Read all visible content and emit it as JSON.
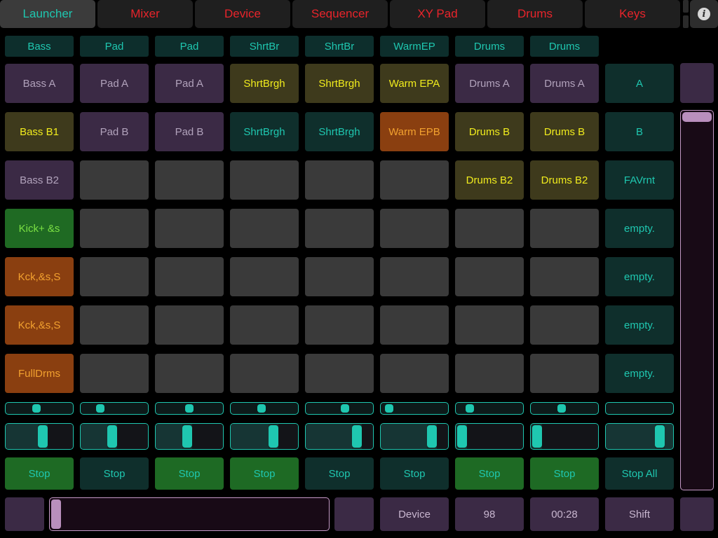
{
  "tabs": [
    {
      "label": "Launcher",
      "active": true
    },
    {
      "label": "Mixer",
      "active": false
    },
    {
      "label": "Device",
      "active": false
    },
    {
      "label": "Sequencer",
      "active": false
    },
    {
      "label": "XY Pad",
      "active": false
    },
    {
      "label": "Drums",
      "active": false
    },
    {
      "label": "Keys",
      "active": false
    }
  ],
  "info_icon": {
    "glyph": "i",
    "icon": "info-icon"
  },
  "tracks": [
    {
      "name": "Bass",
      "clips": [
        {
          "label": "Bass A",
          "style": "purple"
        },
        {
          "label": "Bass B1",
          "style": "olive"
        },
        {
          "label": "Bass B2",
          "style": "purple"
        },
        {
          "label": "Kick+ &s",
          "style": "green"
        },
        {
          "label": "Kck,&s,S",
          "style": "orange"
        },
        {
          "label": "Kck,&s,S",
          "style": "orange"
        },
        {
          "label": "FullDrms",
          "style": "orange"
        }
      ],
      "pan": 0.45,
      "volume": 0.55,
      "stop_label": "Stop",
      "stop_style": "green"
    },
    {
      "name": "Pad",
      "clips": [
        {
          "label": "Pad A",
          "style": "purple"
        },
        {
          "label": "Pad B",
          "style": "purple"
        },
        {
          "label": "",
          "style": "empty"
        },
        {
          "label": "",
          "style": "empty"
        },
        {
          "label": "",
          "style": "empty"
        },
        {
          "label": "",
          "style": "empty"
        },
        {
          "label": "",
          "style": "empty"
        }
      ],
      "pan": 0.25,
      "volume": 0.45,
      "stop_label": "Stop",
      "stop_style": "dark"
    },
    {
      "name": "Pad",
      "clips": [
        {
          "label": "Pad A",
          "style": "purple"
        },
        {
          "label": "Pad B",
          "style": "purple"
        },
        {
          "label": "",
          "style": "empty"
        },
        {
          "label": "",
          "style": "empty"
        },
        {
          "label": "",
          "style": "empty"
        },
        {
          "label": "",
          "style": "empty"
        },
        {
          "label": "",
          "style": "empty"
        }
      ],
      "pan": 0.5,
      "volume": 0.45,
      "stop_label": "Stop",
      "stop_style": "green"
    },
    {
      "name": "ShrtBr",
      "clips": [
        {
          "label": "ShrtBrgh",
          "style": "olive"
        },
        {
          "label": "ShrtBrgh",
          "style": "teal"
        },
        {
          "label": "",
          "style": "empty"
        },
        {
          "label": "",
          "style": "empty"
        },
        {
          "label": "",
          "style": "empty"
        },
        {
          "label": "",
          "style": "empty"
        },
        {
          "label": "",
          "style": "empty"
        }
      ],
      "pan": 0.45,
      "volume": 0.65,
      "stop_label": "Stop",
      "stop_style": "green"
    },
    {
      "name": "ShrtBr",
      "clips": [
        {
          "label": "ShrtBrgh",
          "style": "olive"
        },
        {
          "label": "ShrtBrgh",
          "style": "teal"
        },
        {
          "label": "",
          "style": "empty"
        },
        {
          "label": "",
          "style": "empty"
        },
        {
          "label": "",
          "style": "empty"
        },
        {
          "label": "",
          "style": "empty"
        },
        {
          "label": "",
          "style": "empty"
        }
      ],
      "pan": 0.6,
      "volume": 0.8,
      "stop_label": "Stop",
      "stop_style": "dark"
    },
    {
      "name": "WarmEP",
      "clips": [
        {
          "label": "Warm EPA",
          "style": "olive"
        },
        {
          "label": "Warm EPB",
          "style": "orange"
        },
        {
          "label": "",
          "style": "empty"
        },
        {
          "label": "",
          "style": "empty"
        },
        {
          "label": "",
          "style": "empty"
        },
        {
          "label": "",
          "style": "empty"
        },
        {
          "label": "",
          "style": "empty"
        }
      ],
      "pan": 0.05,
      "volume": 0.8,
      "stop_label": "Stop",
      "stop_style": "dark"
    },
    {
      "name": "Drums",
      "clips": [
        {
          "label": "Drums A",
          "style": "purple"
        },
        {
          "label": "Drums B",
          "style": "olive"
        },
        {
          "label": "Drums B2",
          "style": "olive"
        },
        {
          "label": "",
          "style": "empty"
        },
        {
          "label": "",
          "style": "empty"
        },
        {
          "label": "",
          "style": "empty"
        },
        {
          "label": "",
          "style": "empty"
        }
      ],
      "pan": 0.15,
      "volume": 0.0,
      "stop_label": "Stop",
      "stop_style": "green"
    },
    {
      "name": "Drums",
      "clips": [
        {
          "label": "Drums A",
          "style": "purple"
        },
        {
          "label": "Drums B",
          "style": "olive"
        },
        {
          "label": "Drums B2",
          "style": "olive"
        },
        {
          "label": "",
          "style": "empty"
        },
        {
          "label": "",
          "style": "empty"
        },
        {
          "label": "",
          "style": "empty"
        },
        {
          "label": "",
          "style": "empty"
        }
      ],
      "pan": 0.45,
      "volume": 0.0,
      "stop_label": "Stop",
      "stop_style": "green"
    }
  ],
  "scenes": [
    "A",
    "B",
    "FAVrnt",
    "empty.",
    "empty.",
    "empty.",
    "empty."
  ],
  "master": {
    "pan": null,
    "volume": 0.85,
    "stop_all_label": "Stop All"
  },
  "bottom": {
    "device_label": "Device",
    "value": "98",
    "time": "00:28",
    "shift_label": "Shift",
    "h_scroll_position": 0.0
  },
  "vertical_scroll_position": 0.0,
  "colors": {
    "accent": "#1fc7b0",
    "tab_text": "#e8242b",
    "clip_purple": "#3b2a45",
    "clip_olive": "#3e3a1c",
    "clip_orange": "#8a3f10",
    "clip_green": "#1f6a23"
  }
}
